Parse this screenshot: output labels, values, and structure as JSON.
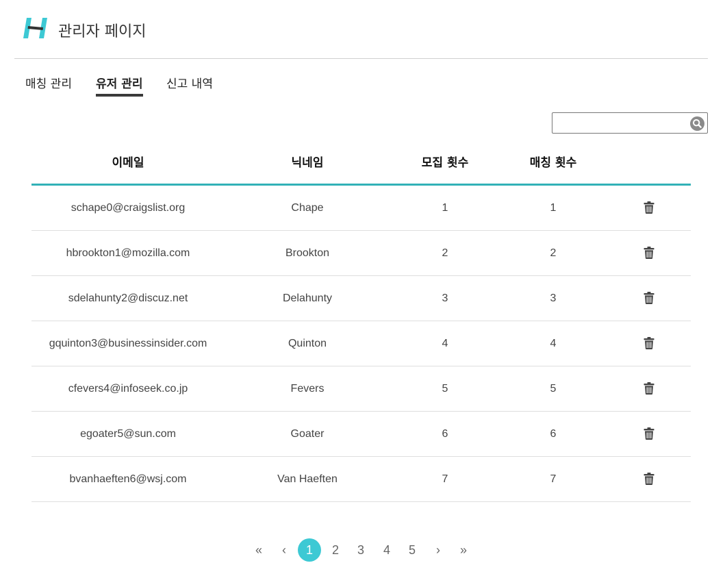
{
  "header": {
    "title": "관리자 페이지",
    "brand_colors": {
      "primary": "#3dc9d4",
      "dark": "#333333"
    },
    "logo_icon": "h-logo-icon"
  },
  "tabs": [
    {
      "label": "매칭 관리",
      "active": false
    },
    {
      "label": "유저 관리",
      "active": true
    },
    {
      "label": "신고 내역",
      "active": false
    }
  ],
  "search": {
    "placeholder": "",
    "value": "",
    "icon": "search-icon"
  },
  "table": {
    "columns": [
      "이메일",
      "닉네임",
      "모집 횟수",
      "매칭 횟수",
      ""
    ],
    "rows": [
      {
        "email": "schape0@craigslist.org",
        "nickname": "Chape",
        "recruit_count": "1",
        "match_count": "1"
      },
      {
        "email": "hbrookton1@mozilla.com",
        "nickname": "Brookton",
        "recruit_count": "2",
        "match_count": "2"
      },
      {
        "email": "sdelahunty2@discuz.net",
        "nickname": "Delahunty",
        "recruit_count": "3",
        "match_count": "3"
      },
      {
        "email": "gquinton3@businessinsider.com",
        "nickname": "Quinton",
        "recruit_count": "4",
        "match_count": "4"
      },
      {
        "email": "cfevers4@infoseek.co.jp",
        "nickname": "Fevers",
        "recruit_count": "5",
        "match_count": "5"
      },
      {
        "email": "egoater5@sun.com",
        "nickname": "Goater",
        "recruit_count": "6",
        "match_count": "6"
      },
      {
        "email": "bvanhaeften6@wsj.com",
        "nickname": "Van Haeften",
        "recruit_count": "7",
        "match_count": "7"
      }
    ],
    "row_action_icon": "trash-icon",
    "header_underline_color": "#32b1b7"
  },
  "pagination": {
    "first": "«",
    "prev": "‹",
    "pages": [
      "1",
      "2",
      "3",
      "4",
      "5"
    ],
    "current": "1",
    "next": "›",
    "last": "»"
  }
}
